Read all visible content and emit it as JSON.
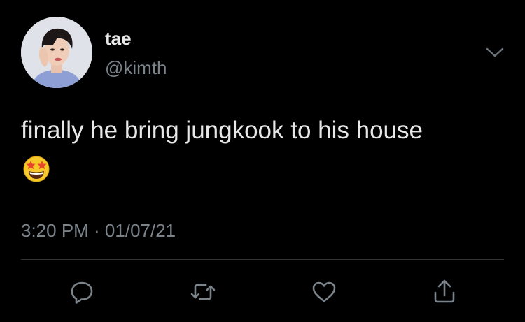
{
  "author": {
    "display_name": "tae",
    "handle": "@kimth"
  },
  "tweet": {
    "text": "finally he bring jungkook to his house",
    "emoji": "star-struck-emoji",
    "timestamp": "3:20 PM · 01/07/21"
  },
  "actions": [
    {
      "icon": "reply-icon"
    },
    {
      "icon": "retweet-icon"
    },
    {
      "icon": "like-icon"
    },
    {
      "icon": "share-icon"
    }
  ],
  "colors": {
    "background": "#000000",
    "primary_text": "#e8e8e8",
    "secondary_text": "#7b838b",
    "divider": "#2f3336",
    "emoji_face": "#f6c82a"
  }
}
